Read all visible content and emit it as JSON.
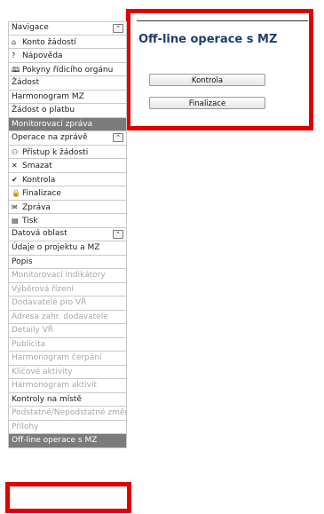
{
  "content": {
    "title": "Off-line operace s MZ",
    "buttons": [
      {
        "label": "Kontrola"
      },
      {
        "label": "Finalizace"
      }
    ]
  },
  "sidebar": {
    "navigace": {
      "header": "Navigace",
      "items": [
        {
          "label": "Konto žádostí",
          "icon": "⌂"
        },
        {
          "label": "Nápověda",
          "icon": "?"
        },
        {
          "label": "Pokyny řídicího orgánu",
          "icon": "🕮"
        }
      ]
    },
    "plain_items": [
      {
        "label": "Žádost"
      },
      {
        "label": "Harmonogram MZ"
      },
      {
        "label": "Žádost o platbu"
      }
    ],
    "active_section": "Monitorovací zpráva",
    "operace": {
      "header": "Operace na zprávě",
      "items": [
        {
          "label": "Přístup k žádosti",
          "icon": "⚇"
        },
        {
          "label": "Smazat",
          "icon": "✕"
        },
        {
          "label": "Kontrola",
          "icon": "✔"
        },
        {
          "label": "Finalizace",
          "icon": "🔒"
        },
        {
          "label": "Zpráva",
          "icon": "✉"
        },
        {
          "label": "Tisk",
          "icon": "▤"
        }
      ]
    },
    "datova": {
      "header": "Datová oblast",
      "items": [
        {
          "label": "Údaje o projektu a MZ",
          "enabled": true
        },
        {
          "label": "Popis",
          "enabled": true
        },
        {
          "label": "Monitorovací indikátory",
          "enabled": false
        },
        {
          "label": "Výběrová řízení",
          "enabled": false
        },
        {
          "label": "Dodavatelé pro VŘ",
          "enabled": false
        },
        {
          "label": "Adresa zahr. dodavatele",
          "enabled": false
        },
        {
          "label": "Detaily VŘ",
          "enabled": false
        },
        {
          "label": "Publicita",
          "enabled": false
        },
        {
          "label": "Harmonogram čerpání",
          "enabled": false
        },
        {
          "label": "Klíčové aktivity",
          "enabled": false
        },
        {
          "label": "Harmonogram aktivit",
          "enabled": false
        },
        {
          "label": "Kontroly na místě",
          "enabled": true
        },
        {
          "label": "Podstatné/Nepodstatné změny",
          "enabled": false
        },
        {
          "label": "Přílohy",
          "enabled": false
        }
      ]
    },
    "selected_item": "Off-line operace s MZ"
  },
  "icons": {
    "collapse": "chevron-up-icon"
  },
  "colors": {
    "highlight": "#e00000",
    "title": "#1f3f70",
    "dark_row": "#7b7b7b"
  }
}
